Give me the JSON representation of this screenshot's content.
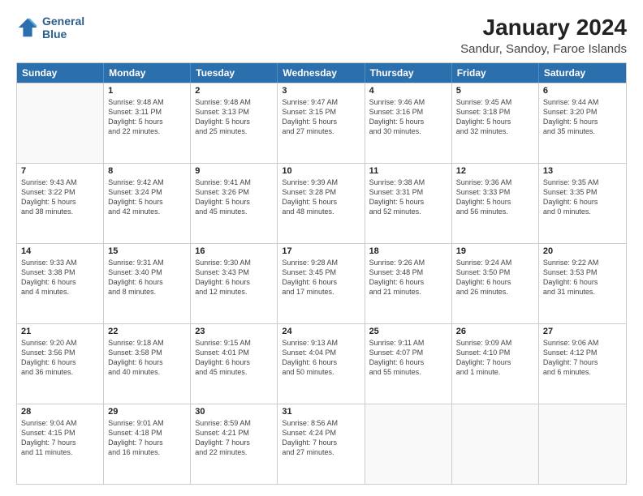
{
  "logo": {
    "line1": "General",
    "line2": "Blue"
  },
  "title": "January 2024",
  "subtitle": "Sandur, Sandoy, Faroe Islands",
  "headers": [
    "Sunday",
    "Monday",
    "Tuesday",
    "Wednesday",
    "Thursday",
    "Friday",
    "Saturday"
  ],
  "weeks": [
    [
      {
        "day": "",
        "lines": []
      },
      {
        "day": "1",
        "lines": [
          "Sunrise: 9:48 AM",
          "Sunset: 3:11 PM",
          "Daylight: 5 hours",
          "and 22 minutes."
        ]
      },
      {
        "day": "2",
        "lines": [
          "Sunrise: 9:48 AM",
          "Sunset: 3:13 PM",
          "Daylight: 5 hours",
          "and 25 minutes."
        ]
      },
      {
        "day": "3",
        "lines": [
          "Sunrise: 9:47 AM",
          "Sunset: 3:15 PM",
          "Daylight: 5 hours",
          "and 27 minutes."
        ]
      },
      {
        "day": "4",
        "lines": [
          "Sunrise: 9:46 AM",
          "Sunset: 3:16 PM",
          "Daylight: 5 hours",
          "and 30 minutes."
        ]
      },
      {
        "day": "5",
        "lines": [
          "Sunrise: 9:45 AM",
          "Sunset: 3:18 PM",
          "Daylight: 5 hours",
          "and 32 minutes."
        ]
      },
      {
        "day": "6",
        "lines": [
          "Sunrise: 9:44 AM",
          "Sunset: 3:20 PM",
          "Daylight: 5 hours",
          "and 35 minutes."
        ]
      }
    ],
    [
      {
        "day": "7",
        "lines": [
          "Sunrise: 9:43 AM",
          "Sunset: 3:22 PM",
          "Daylight: 5 hours",
          "and 38 minutes."
        ]
      },
      {
        "day": "8",
        "lines": [
          "Sunrise: 9:42 AM",
          "Sunset: 3:24 PM",
          "Daylight: 5 hours",
          "and 42 minutes."
        ]
      },
      {
        "day": "9",
        "lines": [
          "Sunrise: 9:41 AM",
          "Sunset: 3:26 PM",
          "Daylight: 5 hours",
          "and 45 minutes."
        ]
      },
      {
        "day": "10",
        "lines": [
          "Sunrise: 9:39 AM",
          "Sunset: 3:28 PM",
          "Daylight: 5 hours",
          "and 48 minutes."
        ]
      },
      {
        "day": "11",
        "lines": [
          "Sunrise: 9:38 AM",
          "Sunset: 3:31 PM",
          "Daylight: 5 hours",
          "and 52 minutes."
        ]
      },
      {
        "day": "12",
        "lines": [
          "Sunrise: 9:36 AM",
          "Sunset: 3:33 PM",
          "Daylight: 5 hours",
          "and 56 minutes."
        ]
      },
      {
        "day": "13",
        "lines": [
          "Sunrise: 9:35 AM",
          "Sunset: 3:35 PM",
          "Daylight: 6 hours",
          "and 0 minutes."
        ]
      }
    ],
    [
      {
        "day": "14",
        "lines": [
          "Sunrise: 9:33 AM",
          "Sunset: 3:38 PM",
          "Daylight: 6 hours",
          "and 4 minutes."
        ]
      },
      {
        "day": "15",
        "lines": [
          "Sunrise: 9:31 AM",
          "Sunset: 3:40 PM",
          "Daylight: 6 hours",
          "and 8 minutes."
        ]
      },
      {
        "day": "16",
        "lines": [
          "Sunrise: 9:30 AM",
          "Sunset: 3:43 PM",
          "Daylight: 6 hours",
          "and 12 minutes."
        ]
      },
      {
        "day": "17",
        "lines": [
          "Sunrise: 9:28 AM",
          "Sunset: 3:45 PM",
          "Daylight: 6 hours",
          "and 17 minutes."
        ]
      },
      {
        "day": "18",
        "lines": [
          "Sunrise: 9:26 AM",
          "Sunset: 3:48 PM",
          "Daylight: 6 hours",
          "and 21 minutes."
        ]
      },
      {
        "day": "19",
        "lines": [
          "Sunrise: 9:24 AM",
          "Sunset: 3:50 PM",
          "Daylight: 6 hours",
          "and 26 minutes."
        ]
      },
      {
        "day": "20",
        "lines": [
          "Sunrise: 9:22 AM",
          "Sunset: 3:53 PM",
          "Daylight: 6 hours",
          "and 31 minutes."
        ]
      }
    ],
    [
      {
        "day": "21",
        "lines": [
          "Sunrise: 9:20 AM",
          "Sunset: 3:56 PM",
          "Daylight: 6 hours",
          "and 36 minutes."
        ]
      },
      {
        "day": "22",
        "lines": [
          "Sunrise: 9:18 AM",
          "Sunset: 3:58 PM",
          "Daylight: 6 hours",
          "and 40 minutes."
        ]
      },
      {
        "day": "23",
        "lines": [
          "Sunrise: 9:15 AM",
          "Sunset: 4:01 PM",
          "Daylight: 6 hours",
          "and 45 minutes."
        ]
      },
      {
        "day": "24",
        "lines": [
          "Sunrise: 9:13 AM",
          "Sunset: 4:04 PM",
          "Daylight: 6 hours",
          "and 50 minutes."
        ]
      },
      {
        "day": "25",
        "lines": [
          "Sunrise: 9:11 AM",
          "Sunset: 4:07 PM",
          "Daylight: 6 hours",
          "and 55 minutes."
        ]
      },
      {
        "day": "26",
        "lines": [
          "Sunrise: 9:09 AM",
          "Sunset: 4:10 PM",
          "Daylight: 7 hours",
          "and 1 minute."
        ]
      },
      {
        "day": "27",
        "lines": [
          "Sunrise: 9:06 AM",
          "Sunset: 4:12 PM",
          "Daylight: 7 hours",
          "and 6 minutes."
        ]
      }
    ],
    [
      {
        "day": "28",
        "lines": [
          "Sunrise: 9:04 AM",
          "Sunset: 4:15 PM",
          "Daylight: 7 hours",
          "and 11 minutes."
        ]
      },
      {
        "day": "29",
        "lines": [
          "Sunrise: 9:01 AM",
          "Sunset: 4:18 PM",
          "Daylight: 7 hours",
          "and 16 minutes."
        ]
      },
      {
        "day": "30",
        "lines": [
          "Sunrise: 8:59 AM",
          "Sunset: 4:21 PM",
          "Daylight: 7 hours",
          "and 22 minutes."
        ]
      },
      {
        "day": "31",
        "lines": [
          "Sunrise: 8:56 AM",
          "Sunset: 4:24 PM",
          "Daylight: 7 hours",
          "and 27 minutes."
        ]
      },
      {
        "day": "",
        "lines": []
      },
      {
        "day": "",
        "lines": []
      },
      {
        "day": "",
        "lines": []
      }
    ]
  ]
}
